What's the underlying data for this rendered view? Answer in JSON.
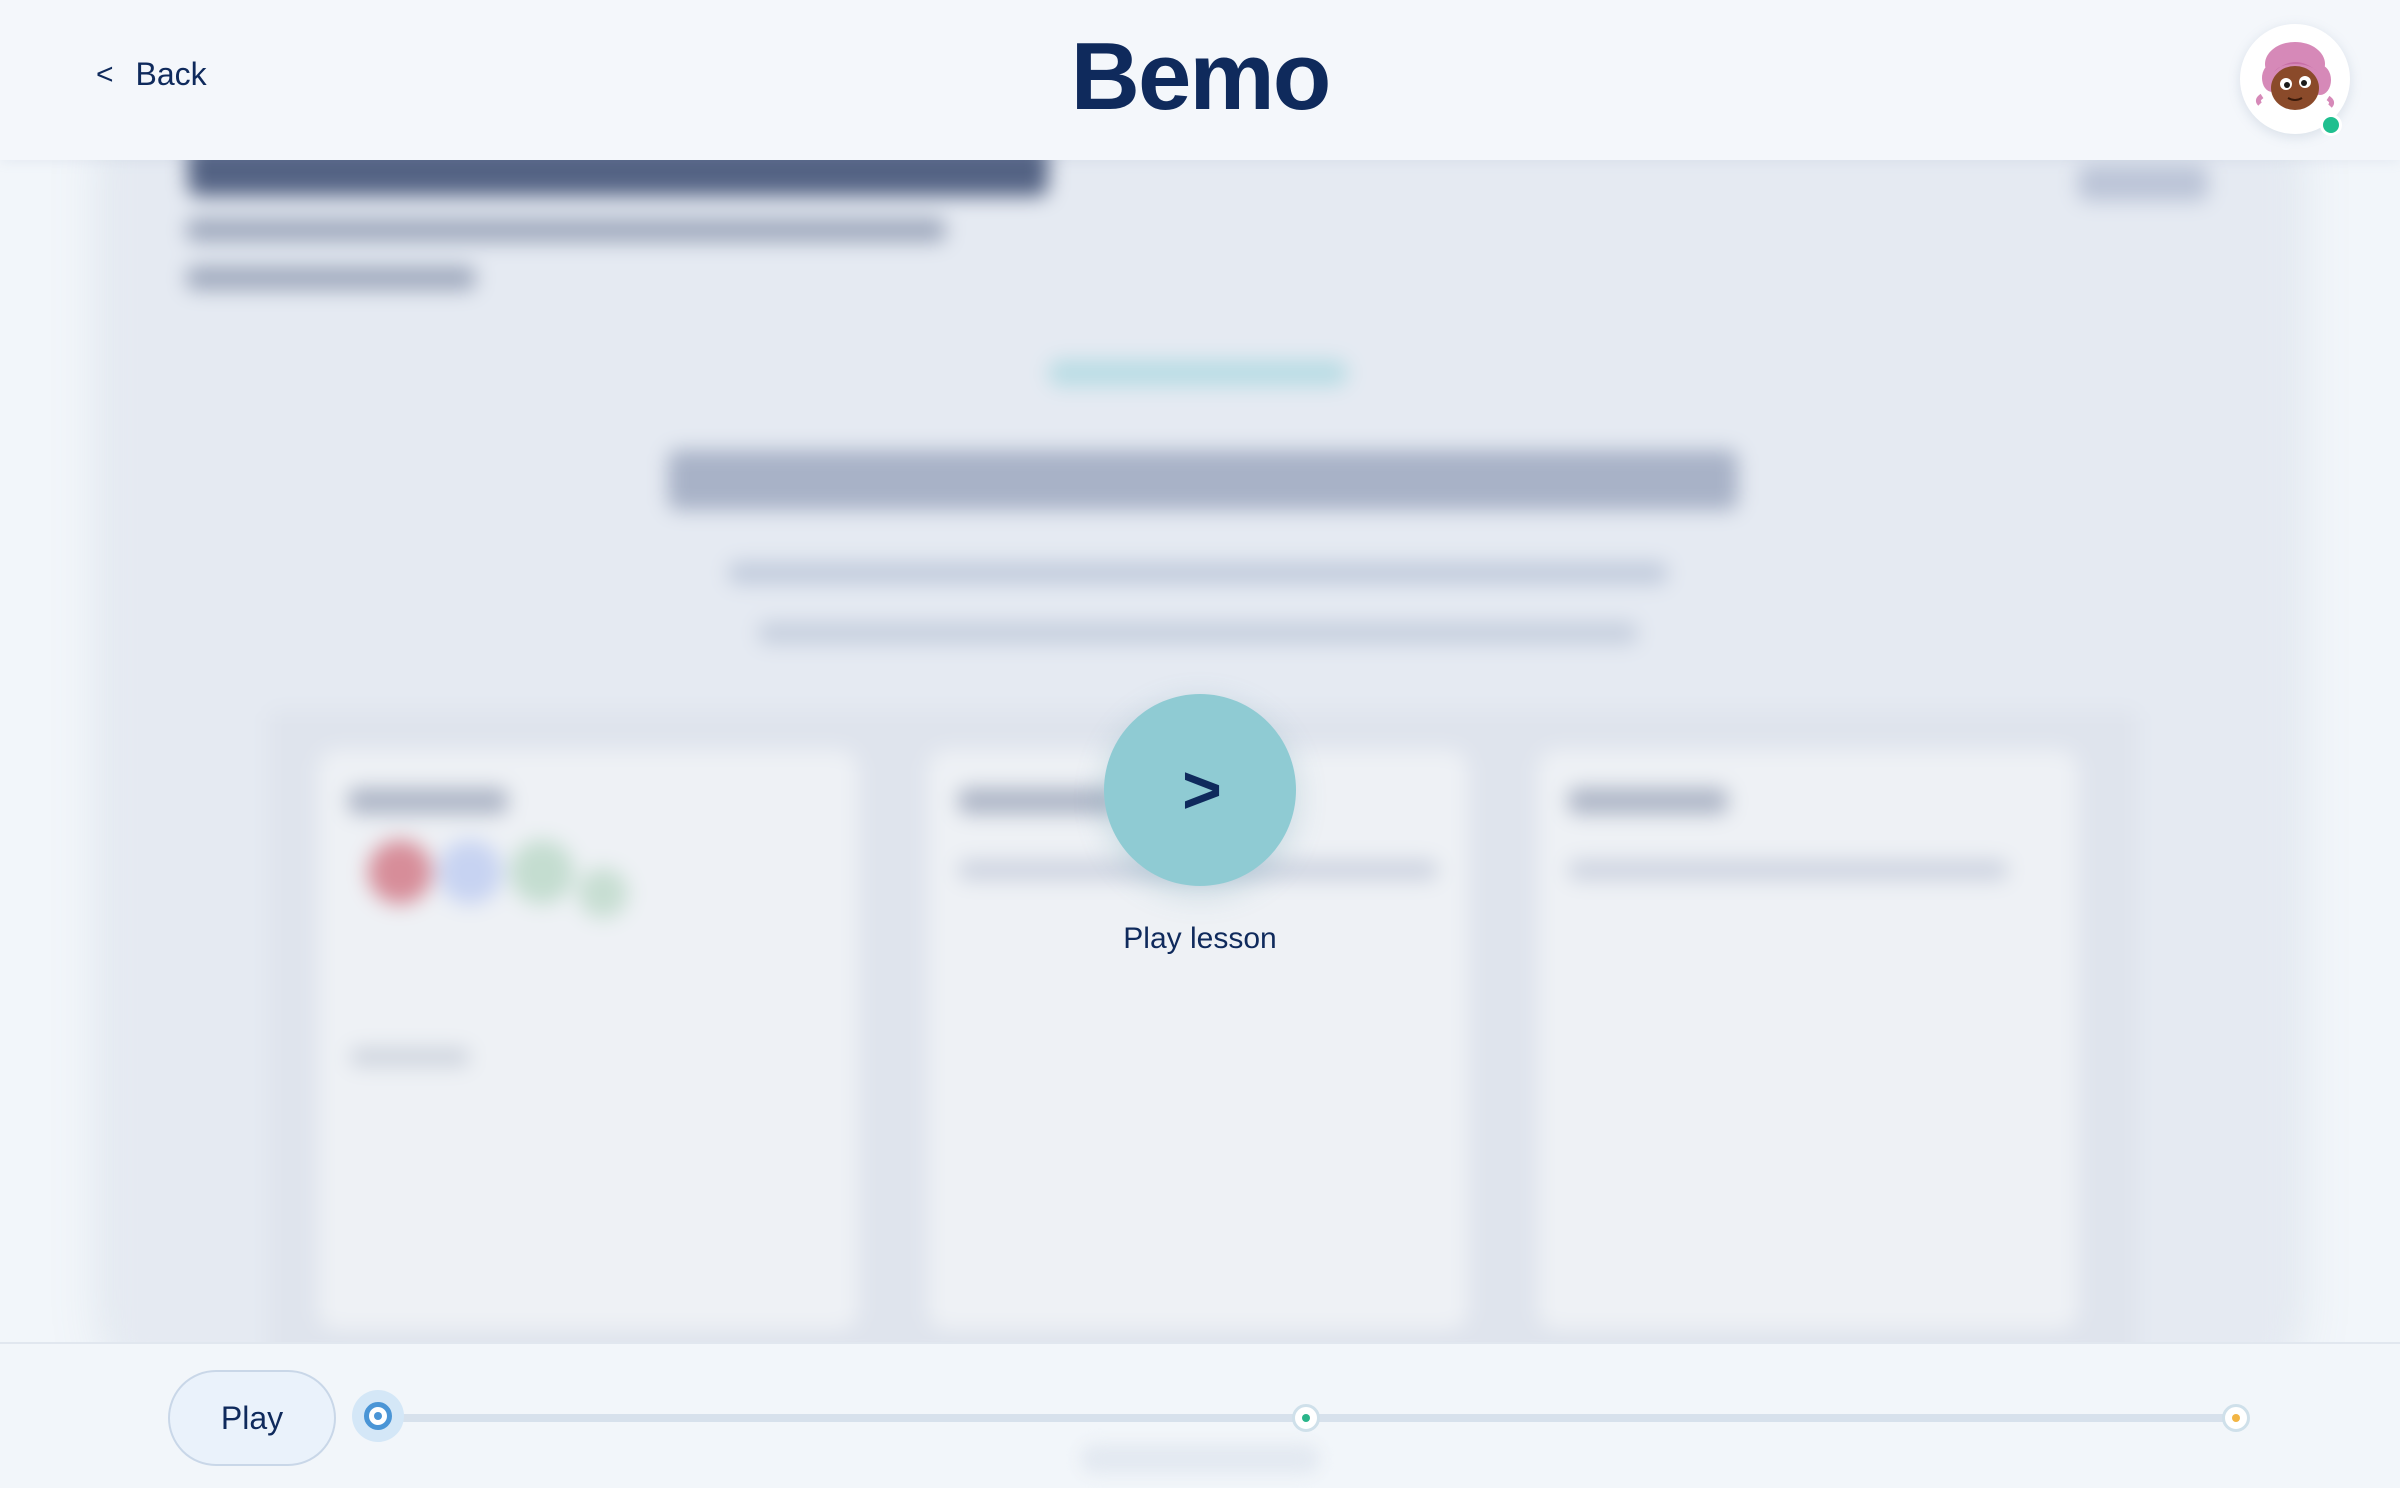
{
  "header": {
    "back_label": "Back",
    "back_chevron": "<",
    "logo": "Bemo",
    "avatar_icon": "user-avatar-icon",
    "status_color": "#1fbf8f"
  },
  "overlay": {
    "play_glyph": ">",
    "play_label": "Play lesson",
    "accent": "#8fcbd3"
  },
  "bottom_bar": {
    "play_label": "Play",
    "timeline_markers": [
      {
        "name": "current",
        "color": "#4a95d6"
      },
      {
        "name": "mid",
        "color": "#2ab58a"
      },
      {
        "name": "end",
        "color": "#f2b544"
      }
    ],
    "progress": 0
  },
  "colors": {
    "primary_text": "#0f2a5c",
    "background": "#f2f6fa"
  }
}
